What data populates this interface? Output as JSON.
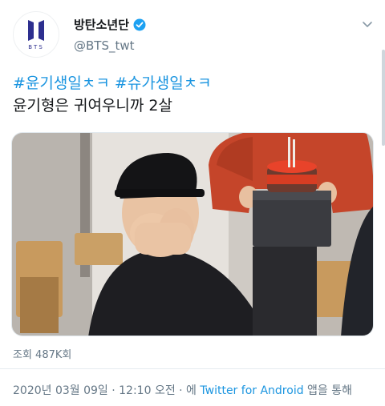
{
  "profile": {
    "display_name": "방탄소년단",
    "handle": "@BTS_twt",
    "logo_text": "BTS",
    "verified": true,
    "icons": {
      "verified": "verified-badge-icon",
      "menu": "chevron-down-icon"
    }
  },
  "tweet": {
    "hashtag_1": "#윤기생일ㅊㅋ",
    "hashtag_2": "#슈가생일ㅊㅋ",
    "text": "윤기형은 귀여우니까 2살",
    "colors": {
      "hashtag": "#1b95e0",
      "text": "#14171a"
    }
  },
  "media": {
    "type": "video-thumbnail",
    "description_icon": "video-thumbnail-image"
  },
  "stats": {
    "views_label": "조회 487K회"
  },
  "footer": {
    "timestamp": "2020년 03월 09일 · 12:10 오전 · 에",
    "source": "Twitter for Android",
    "suffix": "앱을 통해"
  }
}
